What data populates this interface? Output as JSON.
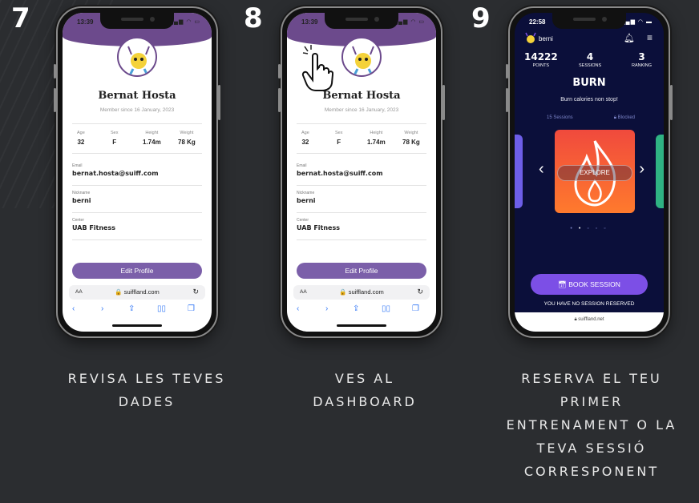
{
  "steps": [
    {
      "number": "7",
      "caption_lines": [
        "REVISA LES TEVES",
        "DADES"
      ],
      "screen": "profile"
    },
    {
      "number": "8",
      "caption_lines": [
        "VES AL",
        "DASHBOARD"
      ],
      "screen": "profile"
    },
    {
      "number": "9",
      "caption_lines": [
        "RESERVA EL TEU",
        "PRIMER",
        "ENTRENAMENT O LA",
        "TEVA SESSIÓ",
        "CORRESPONENT"
      ],
      "screen": "dashboard"
    }
  ],
  "profile": {
    "time": "13:39",
    "name": "Bernat Hosta",
    "member_since": "Member since 16 January, 2023",
    "stats": [
      {
        "label": "Age",
        "value": "32"
      },
      {
        "label": "Sex",
        "value": "F"
      },
      {
        "label": "Height",
        "value": "1.74m"
      },
      {
        "label": "Weight",
        "value": "78 Kg"
      }
    ],
    "fields": [
      {
        "label": "Email",
        "value": "bernat.hosta@suiff.com"
      },
      {
        "label": "Nickname",
        "value": "berni"
      },
      {
        "label": "Center",
        "value": "UAB Fitness"
      }
    ],
    "edit_button": "Edit Profile",
    "url_aa": "AA",
    "url": "suiffland.com",
    "accent": "#6c4a8c"
  },
  "dashboard": {
    "time": "22:58",
    "username": "berni",
    "stats": [
      {
        "value": "14222",
        "label": "POINTS"
      },
      {
        "value": "4",
        "label": "SESSIONS"
      },
      {
        "value": "3",
        "label": "RANKING"
      }
    ],
    "title": "BURN",
    "subtitle": "Burn calories non stop!",
    "sessions": "15 Sessions",
    "blocked": "Blocked",
    "explore": "EXPLORE",
    "book": "BOOK SESSION",
    "no_reserved": "YOU HAVE NO SESSION RESERVED",
    "url": "suiffland.net",
    "accent": "#7c4fe6"
  }
}
